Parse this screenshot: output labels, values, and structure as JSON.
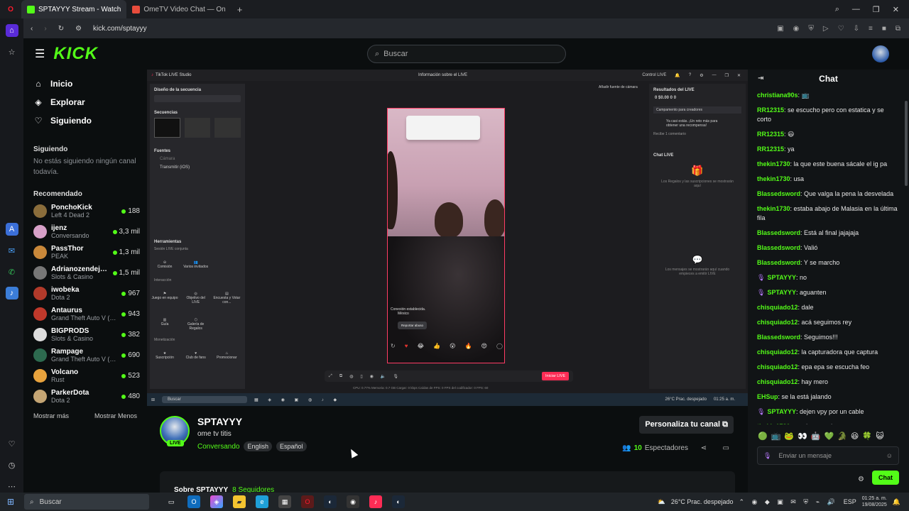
{
  "browser": {
    "tabs": [
      {
        "label": "SPTAYYY Stream - Watch",
        "active": true
      },
      {
        "label": "OmeTV Video Chat — On",
        "active": false
      }
    ],
    "new_tab": "+",
    "url": "kick.com/sptayyy"
  },
  "kick": {
    "logo": "KICK",
    "search_placeholder": "Buscar",
    "nav": [
      {
        "icon": "home-icon",
        "label": "Inicio"
      },
      {
        "icon": "compass-icon",
        "label": "Explorar"
      },
      {
        "icon": "heart-icon",
        "label": "Siguiendo"
      }
    ],
    "following_title": "Siguiendo",
    "following_empty": "No estás siguiendo ningún canal todavía.",
    "recommended_title": "Recomendado",
    "recommended": [
      {
        "name": "PonchoKick",
        "game": "Left 4 Dead 2",
        "viewers": "188",
        "color": "#8a6d3b"
      },
      {
        "name": "ijenz",
        "game": "Conversando",
        "viewers": "3,3 mil",
        "color": "#d7a0c8"
      },
      {
        "name": "PassThor",
        "game": "PEAK",
        "viewers": "1,3 mil",
        "color": "#c9883a"
      },
      {
        "name": "Adrianozendeja...",
        "game": "Slots & Casino",
        "viewers": "1,5 mil",
        "color": "#777"
      },
      {
        "name": "iwobeka",
        "game": "Dota 2",
        "viewers": "967",
        "color": "#b23a2a"
      },
      {
        "name": "Antaurus",
        "game": "Grand Theft Auto V (G...",
        "viewers": "943",
        "color": "#c0392b"
      },
      {
        "name": "BIGPRODS",
        "game": "Slots & Casino",
        "viewers": "382",
        "color": "#ddd"
      },
      {
        "name": "Rampage",
        "game": "Grand Theft Auto V (G...",
        "viewers": "690",
        "color": "#2d6a4f"
      },
      {
        "name": "Volcano",
        "game": "Rust",
        "viewers": "523",
        "color": "#e8a33d"
      },
      {
        "name": "ParkerDota",
        "game": "Dota 2",
        "viewers": "480",
        "color": "#c4a574"
      }
    ],
    "show_more": "Mostrar más",
    "show_less": "Mostrar Menos"
  },
  "studio": {
    "app_title": "TikTok LIVE Studio",
    "center_title": "Información sobre el LIVE",
    "control_live": "Control LIVE",
    "add_camera": "Añadir fuente de cámara",
    "scene_design": "Diseño de la secuencia",
    "sequences": "Secuencias",
    "sources": "Fuentes",
    "source_camera": "Cámara",
    "source_ios": "Transmitir (iOS)",
    "tools": "Herramientas",
    "joint_session": "Sesión LIVE conjunta",
    "tool_a": "Comisión",
    "tool_b": "Varios invitados",
    "interaction": "Interacción",
    "tool_c": "Juego en equipo",
    "tool_d": "Objetivo del LIVE",
    "tool_e": "Encuesta y Votar con...",
    "tool_f": "Guía",
    "tool_g": "Galería de Regalos",
    "monetization": "Monetización",
    "tool_h": "Suscripción",
    "tool_i": "Club de fans",
    "tool_j": "Promocionar",
    "connection": "Conexión establecida.",
    "location": "México",
    "report": "Reportar abuso",
    "start_live": "Iniciar LIVE",
    "stats": "CPU: 0.77%   Memoria: 0.7 GB   Cargar: 0 kbps   Caídas de FPS: 0   FPS del codificador: 0   FPS: 60",
    "results_title": "Resultados del LIVE",
    "results": "0   $0.00   0   0",
    "creators_camp": "Campamento para creadores",
    "creators_tip": "Ya casi estás. ¡Un reto más para obtener una recompensa!",
    "receive_one": "Recibe 1 comentario",
    "chat_live": "Chat LIVE",
    "gifts_note": "Los Regalos y las suscripciones se mostrarán aquí",
    "messages_note": "Los mensajes se mostrarán aquí cuando empieces a emitir LIVE",
    "inner_search": "Buscar",
    "inner_weather": "26°C  Prac. despejado",
    "inner_time": "01:25 a. m."
  },
  "stream": {
    "name": "SPTAYYY",
    "title": "ome tv titis",
    "category": "Conversando",
    "tags": [
      "English",
      "Español"
    ],
    "live_badge": "LIVE",
    "customize": "Personaliza tu canal",
    "viewers_count": "10",
    "viewers_label": "Espectadores",
    "about_prefix": "Sobre SPTAYYY",
    "followers": "8 Seguidores"
  },
  "chat": {
    "title": "Chat",
    "messages": [
      {
        "user": "christiana90s",
        "color": "#53fc18",
        "text": "📺",
        "mic": false
      },
      {
        "user": "RR12315",
        "color": "#53fc18",
        "text": "se escucho pero con estatica y se corto",
        "mic": false
      },
      {
        "user": "RR12315",
        "color": "#53fc18",
        "text": "😃",
        "mic": false
      },
      {
        "user": "RR12315",
        "color": "#53fc18",
        "text": "ya",
        "mic": false
      },
      {
        "user": "thekin1730",
        "color": "#53fc18",
        "text": "la que este buena sácale el ig pa",
        "mic": false
      },
      {
        "user": "thekin1730",
        "color": "#53fc18",
        "text": "usa",
        "mic": false
      },
      {
        "user": "Blassedsword",
        "color": "#53fc18",
        "text": "Que valga la pena la desvelada",
        "mic": false
      },
      {
        "user": "thekin1730",
        "color": "#53fc18",
        "text": "estaba abajo de Malasia en la última fila",
        "mic": false
      },
      {
        "user": "Blassedsword",
        "color": "#53fc18",
        "text": "Está al final jajajaja",
        "mic": false
      },
      {
        "user": "Blassedsword",
        "color": "#53fc18",
        "text": "Valió",
        "mic": false
      },
      {
        "user": "Blassedsword",
        "color": "#53fc18",
        "text": "Y se marcho",
        "mic": false
      },
      {
        "user": "SPTAYYY",
        "color": "#53fc18",
        "text": "no",
        "mic": true
      },
      {
        "user": "SPTAYYY",
        "color": "#53fc18",
        "text": "aguanten",
        "mic": true
      },
      {
        "user": "chisquiado12",
        "color": "#53fc18",
        "text": "dale",
        "mic": false
      },
      {
        "user": "chisquiado12",
        "color": "#53fc18",
        "text": "acá seguimos rey",
        "mic": false
      },
      {
        "user": "Blassedsword",
        "color": "#53fc18",
        "text": "Seguimos!!!",
        "mic": false
      },
      {
        "user": "chisquiado12",
        "color": "#53fc18",
        "text": "la capturadora que captura",
        "mic": false
      },
      {
        "user": "chisquiado12",
        "color": "#53fc18",
        "text": "epa epa se escucha feo",
        "mic": false
      },
      {
        "user": "chisquiado12",
        "color": "#53fc18",
        "text": "hay mero",
        "mic": false
      },
      {
        "user": "EHSup",
        "color": "#53fc18",
        "text": "se la está jalando",
        "mic": false
      },
      {
        "user": "SPTAYYY",
        "color": "#53fc18",
        "text": "dejen vpy por un cable",
        "mic": true
      },
      {
        "user": "thekin1730",
        "color": "#53fc18",
        "text": "que ha pasado",
        "mic": false
      }
    ],
    "input_placeholder": "Enviar un mensaje",
    "send_label": "Chat"
  },
  "taskbar": {
    "search": "Buscar",
    "weather": "26°C  Prac. despejado",
    "lang": "ESP",
    "time": "01:25 a. m.",
    "date": "19/08/2025"
  },
  "colors": {
    "kick_green": "#53fc18",
    "tiktok_red": "#fe2c55",
    "bg": "#0b0e0f"
  }
}
